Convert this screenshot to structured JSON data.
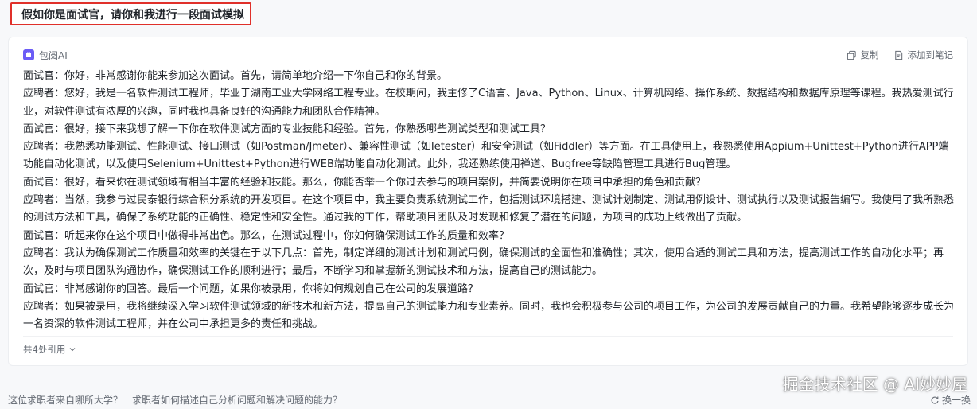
{
  "prompt": {
    "text": "假如你是面试官，请你和我进行一段面试模拟"
  },
  "answer": {
    "brand": "包阅AI",
    "actions": {
      "copy": "复制",
      "add_note": "添加到笔记"
    },
    "lines": [
      "面试官：你好，非常感谢你能来参加这次面试。首先，请简单地介绍一下你自己和你的背景。",
      "应聘者：您好，我是一名软件测试工程师，毕业于湖南工业大学网络工程专业。在校期间，我主修了C语言、Java、Python、Linux、计算机网络、操作系统、数据结构和数据库原理等课程。我热爱测试行业，对软件测试有浓厚的兴趣，同时我也具备良好的沟通能力和团队合作精神。",
      "面试官：很好，接下来我想了解一下你在软件测试方面的专业技能和经验。首先，你熟悉哪些测试类型和测试工具？",
      "应聘者：我熟悉功能测试、性能测试、接口测试（如Postman/Jmeter）、兼容性测试（如Ietester）和安全测试（如Fiddler）等方面。在工具使用上，我熟悉使用Appium+Unittest+Python进行APP端功能自动化测试，以及使用Selenium+Unittest+Python进行WEB端功能自动化测试。此外，我还熟练使用禅道、Bugfree等缺陷管理工具进行Bug管理。",
      "面试官：很好，看来你在测试领域有相当丰富的经验和技能。那么，你能否举一个你过去参与的项目案例，并简要说明你在项目中承担的角色和贡献？",
      "应聘者：当然，我参与过民泰银行综合积分系统的开发项目。在这个项目中，我主要负责系统测试工作，包括测试环境搭建、测试计划制定、测试用例设计、测试执行以及测试报告编写。我使用了我所熟悉的测试方法和工具，确保了系统功能的正确性、稳定性和安全性。通过我的工作，帮助项目团队及时发现和修复了潜在的问题，为项目的成功上线做出了贡献。",
      "面试官：听起来你在这个项目中做得非常出色。那么，在测试过程中，你如何确保测试工作的质量和效率？",
      "应聘者：我认为确保测试工作质量和效率的关键在于以下几点：首先，制定详细的测试计划和测试用例，确保测试的全面性和准确性；其次，使用合适的测试工具和方法，提高测试工作的自动化水平；再次，及时与项目团队沟通协作，确保测试工作的顺利进行；最后，不断学习和掌握新的测试技术和方法，提高自己的测试能力。",
      "面试官：非常感谢你的回答。最后一个问题，如果你被录用，你将如何规划自己在公司的发展道路？",
      "应聘者：如果被录用，我将继续深入学习软件测试领域的新技术和新方法，提高自己的测试能力和专业素养。同时，我也会积极参与公司的项目工作，为公司的发展贡献自己的力量。我希望能够逐步成长为一名资深的软件测试工程师，并在公司中承担更多的责任和挑战。"
    ],
    "refs_label": "共4处引用"
  },
  "followups": [
    "这位求职者来自哪所大学？",
    "求职者如何描述自己分析问题和解决问题的能力？"
  ],
  "refresh_label": "换一换",
  "watermark": "掘金技术社区 @ AI妙妙屋",
  "colors": {
    "highlight_border": "#e0302a",
    "brand": "#6b5cf6"
  }
}
